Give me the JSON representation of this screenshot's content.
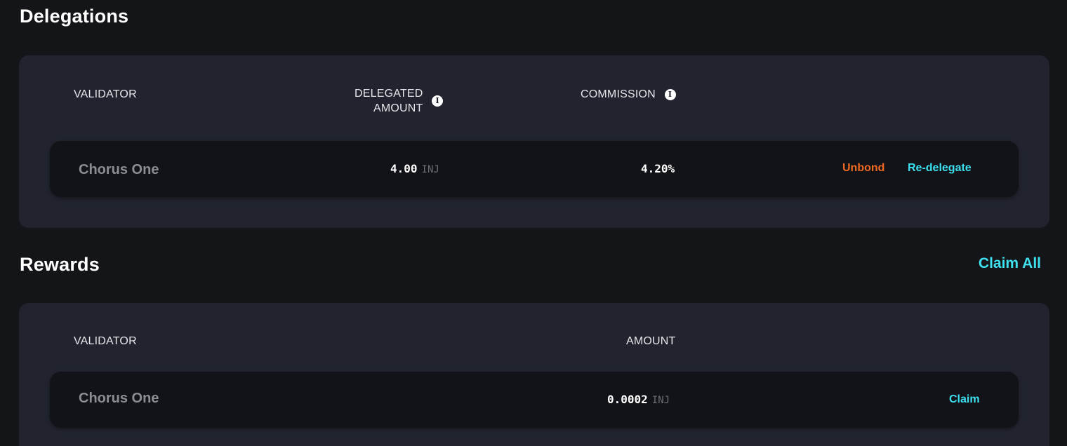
{
  "delegations": {
    "title": "Delegations",
    "headers": {
      "validator": "VALIDATOR",
      "delegated_amount_line1": "DELEGATED",
      "delegated_amount_line2": "AMOUNT",
      "commission": "COMMISSION"
    },
    "rows": [
      {
        "validator": "Chorus One",
        "amount": "4.00",
        "unit": "INJ",
        "commission": "4.20%",
        "unbond_label": "Unbond",
        "redelegate_label": "Re-delegate"
      }
    ]
  },
  "rewards": {
    "title": "Rewards",
    "claim_all_label": "Claim All",
    "headers": {
      "validator": "VALIDATOR",
      "amount": "AMOUNT"
    },
    "rows": [
      {
        "validator": "Chorus One",
        "amount": "0.0002",
        "unit": "INJ",
        "claim_label": "Claim"
      }
    ]
  },
  "icons": {
    "info": "info-icon"
  },
  "colors": {
    "background": "#141519",
    "panel": "#21242e",
    "row": "#121318",
    "accent_cyan": "#3ee0ee",
    "unbond_orange": "#f06a22"
  }
}
